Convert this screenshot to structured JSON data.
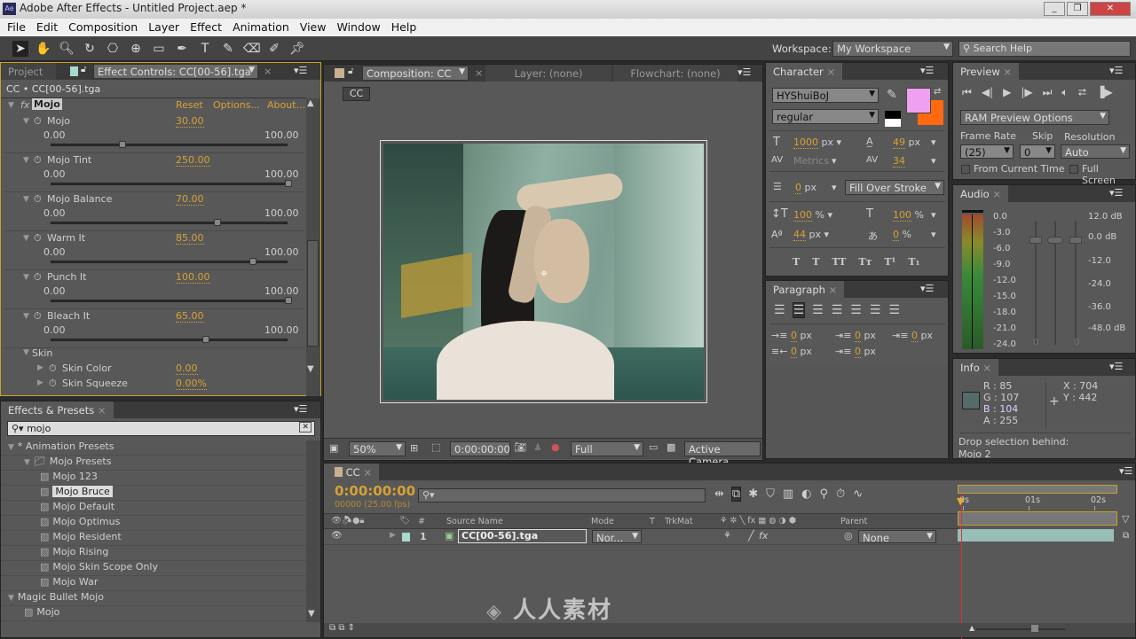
{
  "window": {
    "title": "Adobe After Effects - Untitled Project.aep *",
    "app_icon": "Ae",
    "buttons": [
      "_",
      "❐",
      "✕"
    ]
  },
  "menu": [
    "File",
    "Edit",
    "Composition",
    "Layer",
    "Effect",
    "Animation",
    "View",
    "Window",
    "Help"
  ],
  "toolbar": {
    "tools": [
      "selection-tool",
      "hand-tool",
      "zoom-tool",
      "rotation-tool",
      "camera-tool",
      "pan-behind-tool",
      "rectangle-tool",
      "pen-tool",
      "type-tool",
      "brush-tool",
      "eraser-tool",
      "roto-brush-tool",
      "puppet-tool"
    ],
    "workspace_label": "Workspace:",
    "workspace_value": "My Workspace",
    "search_placeholder": "Search Help"
  },
  "effect_controls": {
    "tab_project": "Project",
    "tab_title": "Effect Controls: CC[00-56].tga",
    "header": "CC • CC[00-56].tga",
    "effect_name": "Mojo",
    "fx": "fx",
    "reset": "Reset",
    "options": "Options...",
    "about": "About...",
    "params": [
      {
        "name": "Mojo",
        "value": "30.00",
        "min": "0.00",
        "max": "100.00",
        "level": 0.3
      },
      {
        "name": "Mojo Tint",
        "value": "250.00",
        "min": "0.00",
        "max": "100.00",
        "level": 1.0
      },
      {
        "name": "Mojo Balance",
        "value": "70.00",
        "min": "0.00",
        "max": "100.00",
        "level": 0.7
      },
      {
        "name": "Warm It",
        "value": "85.00",
        "min": "0.00",
        "max": "100.00",
        "level": 0.85
      },
      {
        "name": "Punch It",
        "value": "100.00",
        "min": "0.00",
        "max": "100.00",
        "level": 1.0
      },
      {
        "name": "Bleach It",
        "value": "65.00",
        "min": "0.00",
        "max": "100.00",
        "level": 0.65
      }
    ],
    "group": "Skin",
    "sub_params": [
      {
        "name": "Skin Color",
        "value": "0.00"
      },
      {
        "name": "Skin Squeeze",
        "value": "0.00%"
      }
    ]
  },
  "effects_presets": {
    "title": "Effects & Presets",
    "search_value": "mojo",
    "items": [
      {
        "label": "* Animation Presets",
        "depth": 0,
        "type": "folder-open"
      },
      {
        "label": "Mojo Presets",
        "depth": 1,
        "type": "folder"
      },
      {
        "label": "Mojo 123",
        "depth": 2,
        "type": "preset"
      },
      {
        "label": "Mojo Bruce",
        "depth": 2,
        "type": "preset",
        "selected": true
      },
      {
        "label": "Mojo Default",
        "depth": 2,
        "type": "preset"
      },
      {
        "label": "Mojo Optimus",
        "depth": 2,
        "type": "preset"
      },
      {
        "label": "Mojo Resident",
        "depth": 2,
        "type": "preset"
      },
      {
        "label": "Mojo Rising",
        "depth": 2,
        "type": "preset"
      },
      {
        "label": "Mojo Skin Scope Only",
        "depth": 2,
        "type": "preset"
      },
      {
        "label": "Mojo War",
        "depth": 2,
        "type": "preset"
      },
      {
        "label": "Magic Bullet Mojo",
        "depth": 0,
        "type": "folder-open"
      },
      {
        "label": "Mojo",
        "depth": 1,
        "type": "effect"
      }
    ]
  },
  "composition": {
    "tab": "Composition: CC",
    "layer_tab": "Layer: (none)",
    "flowchart_tab": "Flowchart: (none)",
    "comp_button": "CC",
    "zoom": "50%",
    "timecode": "0:00:00:00",
    "resolution": "Full",
    "camera": "Active Camera"
  },
  "character": {
    "title": "Character",
    "font": "HYShuiBoJ",
    "style": "regular",
    "fill_color": "#f0a0f0",
    "stroke_color": "#ff6a10",
    "font_size": "1000",
    "leading": "49",
    "kerning": "Metrics",
    "tracking": "34",
    "stroke_width": "0",
    "stroke_mode": "Fill Over Stroke",
    "vscale": "100",
    "hscale": "100",
    "baseline": "44",
    "tsume": "0",
    "unit_px": "px",
    "unit_pct": "%",
    "styles": [
      "T",
      "T",
      "TT",
      "Tт",
      "T¹",
      "T₁"
    ]
  },
  "paragraph": {
    "title": "Paragraph",
    "indents": [
      "0",
      "0",
      "0",
      "0",
      "0"
    ],
    "unit": "px"
  },
  "preview": {
    "title": "Preview",
    "ram_options": "RAM Preview Options",
    "frame_rate_label": "Frame Rate",
    "skip_label": "Skip",
    "resolution_label": "Resolution",
    "frame_rate": "(25)",
    "skip": "0",
    "resolution": "Auto",
    "from_current": "From Current Time",
    "full_screen": "Full Screen"
  },
  "audio": {
    "title": "Audio",
    "scale_left": [
      "0.0",
      "-3.0",
      "-6.0",
      "-9.0",
      "-12.0",
      "-15.0",
      "-18.0",
      "-21.0",
      "-24.0"
    ],
    "scale_right": [
      "12.0 dB",
      "0.0 dB",
      "-12.0",
      "-24.0",
      "-36.0",
      "-48.0 dB"
    ],
    "fader_values": [
      "0",
      "0"
    ]
  },
  "info": {
    "title": "Info",
    "r": "R : 85",
    "g": "G : 107",
    "b": "B : 104",
    "a": "A : 255",
    "x": "X : 704",
    "y": "Y : 442",
    "swatch": "#556b68",
    "message": "Drop selection behind:",
    "message2": "Mojo 2"
  },
  "timeline": {
    "tab": "CC",
    "timecode": "0:00:00:00",
    "fps": "00000 (25.00 fps)",
    "col_source": "Source Name",
    "col_mode": "Mode",
    "col_t": "T",
    "col_trkmat": "TrkMat",
    "col_parent": "Parent",
    "col_num": "#",
    "ruler": [
      "0s",
      "01s",
      "02s"
    ],
    "layers": [
      {
        "num": "1",
        "name": "CC[00-56].tga",
        "mode": "Nor...",
        "parent": "None",
        "label_color": "#a8d8d0"
      }
    ]
  },
  "watermark": "人人素材"
}
